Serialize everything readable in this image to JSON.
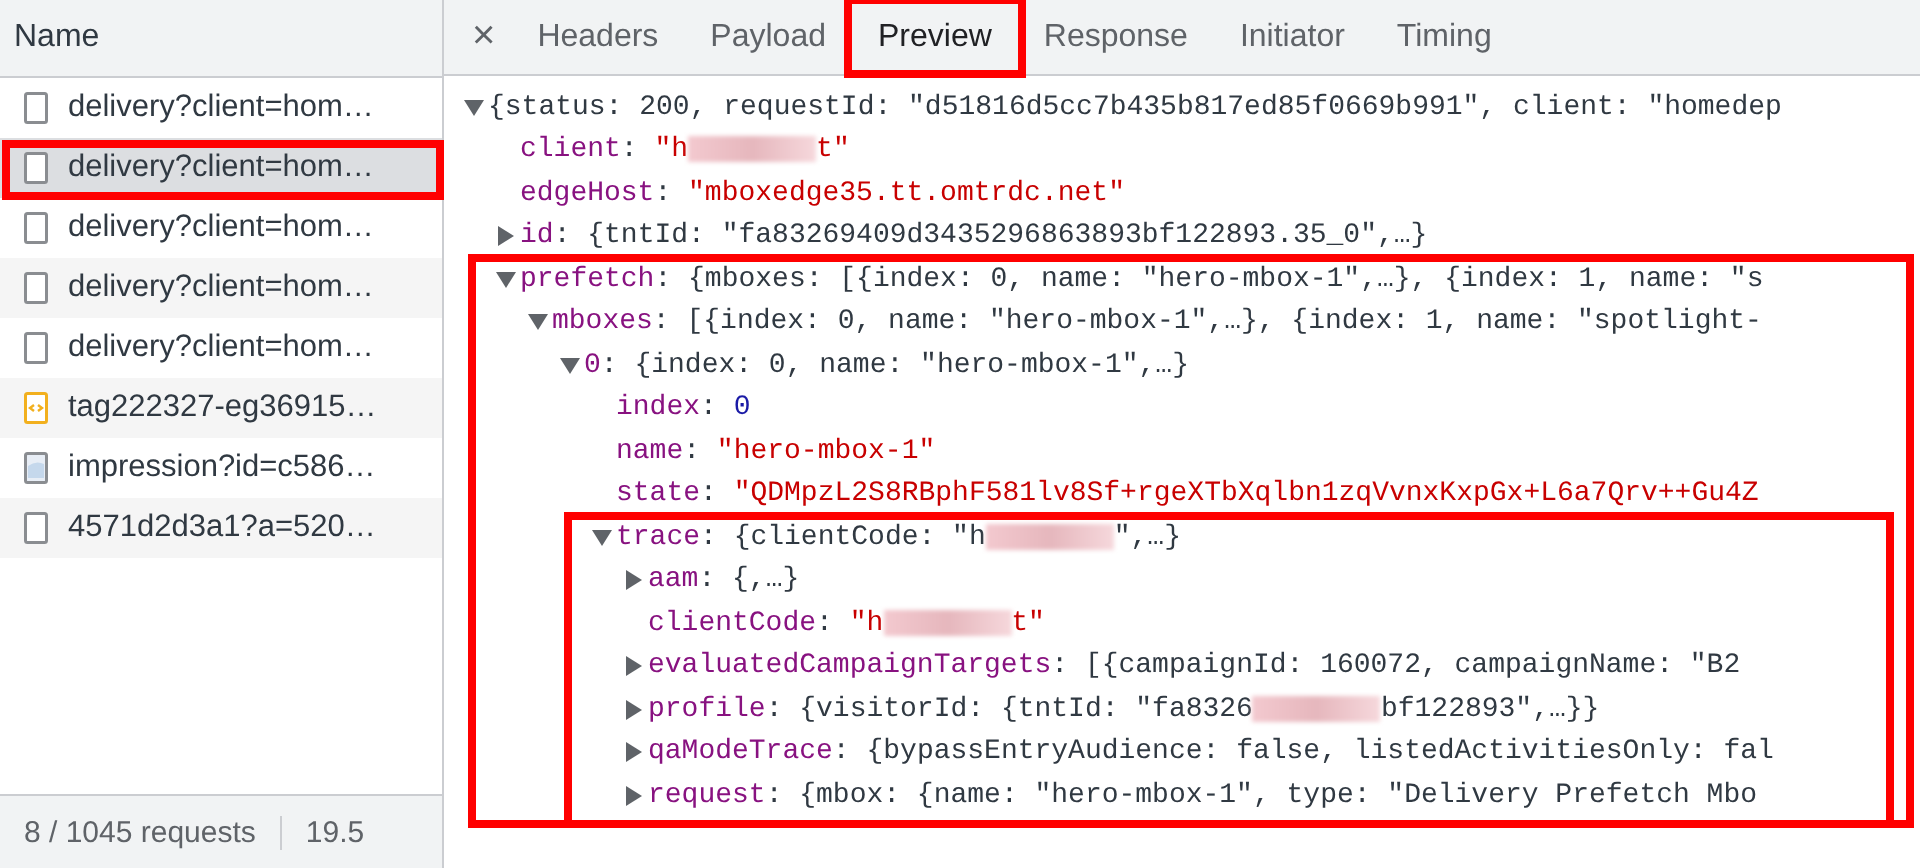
{
  "sidebar": {
    "header": "Name",
    "requests": [
      {
        "name": "delivery?client=hom…",
        "kind": "document",
        "selected": false
      },
      {
        "name": "delivery?client=hom…",
        "kind": "document",
        "selected": true,
        "highlighted": true
      },
      {
        "name": "delivery?client=hom…",
        "kind": "document",
        "selected": false
      },
      {
        "name": "delivery?client=hom…",
        "kind": "document",
        "selected": false
      },
      {
        "name": "delivery?client=hom…",
        "kind": "document",
        "selected": false
      },
      {
        "name": "tag222327-eg36915…",
        "kind": "script",
        "selected": false
      },
      {
        "name": "impression?id=c586…",
        "kind": "image",
        "selected": false
      },
      {
        "name": "4571d2d3a1?a=520…",
        "kind": "document",
        "selected": false
      }
    ],
    "status": [
      "8 / 1045 requests",
      "19.5"
    ]
  },
  "tabs": {
    "close": "×",
    "items": [
      {
        "label": "Headers",
        "selected": false
      },
      {
        "label": "Payload",
        "selected": false
      },
      {
        "label": "Preview",
        "selected": true,
        "highlighted": true
      },
      {
        "label": "Response",
        "selected": false
      },
      {
        "label": "Initiator",
        "selected": false
      },
      {
        "label": "Timing",
        "selected": false
      }
    ]
  },
  "preview": {
    "tree": [
      {
        "expanded": true,
        "value": [
          {
            "kind": "summary",
            "text": "{status: 200, requestId: \"d51816d5cc7b435b817ed85f0669b991\", client: \"homedep"
          }
        ],
        "children": [
          {
            "key": "client",
            "sep": ":",
            "value": [
              {
                "kind": "string",
                "text": "\"h"
              },
              {
                "kind": "redacted"
              },
              {
                "kind": "string",
                "text": "t\""
              }
            ]
          },
          {
            "key": "edgeHost",
            "sep": ":",
            "value": [
              {
                "kind": "string",
                "text": "\"mboxedge35.tt.omtrdc.net\""
              }
            ]
          },
          {
            "key": "id",
            "sep": ":",
            "expanded": false,
            "value": [
              {
                "kind": "summary",
                "text": "{tntId: \"fa83269409d3435296863893bf122893.35_0\",…}"
              }
            ]
          },
          {
            "key": "prefetch",
            "sep": ":",
            "expanded": true,
            "highlighted": true,
            "value": [
              {
                "kind": "summary",
                "text": "{mboxes: [{index: 0, name: \"hero-mbox-1\",…}, {index: 1, name: \"s"
              }
            ],
            "children": [
              {
                "key": "mboxes",
                "sep": ":",
                "expanded": true,
                "value": [
                  {
                    "kind": "summary",
                    "text": "[{index: 0, name: \"hero-mbox-1\",…}, {index: 1, name: \"spotlight-"
                  }
                ],
                "children": [
                  {
                    "key": "0",
                    "sep": ":",
                    "expanded": true,
                    "value": [
                      {
                        "kind": "summary",
                        "text": "{index: 0, name: \"hero-mbox-1\",…}"
                      }
                    ],
                    "children": [
                      {
                        "key": "index",
                        "sep": ":",
                        "value": [
                          {
                            "kind": "number",
                            "text": "0"
                          }
                        ]
                      },
                      {
                        "key": "name",
                        "sep": ":",
                        "value": [
                          {
                            "kind": "string",
                            "text": "\"hero-mbox-1\""
                          }
                        ]
                      },
                      {
                        "key": "state",
                        "sep": ":",
                        "value": [
                          {
                            "kind": "string",
                            "text": "\"QDMpzL2S8RBphF581lv8Sf+rgeXTbXqlbn1zqVvnxKxpGx+L6a7Qrv++Gu4Z"
                          }
                        ]
                      },
                      {
                        "key": "trace",
                        "sep": ":",
                        "expanded": true,
                        "highlighted": true,
                        "value": [
                          {
                            "kind": "summary",
                            "text": "{clientCode: \"h"
                          },
                          {
                            "kind": "redacted"
                          },
                          {
                            "kind": "summary",
                            "text": "\",…}"
                          }
                        ],
                        "children": [
                          {
                            "key": "aam",
                            "sep": ":",
                            "expanded": false,
                            "value": [
                              {
                                "kind": "summary",
                                "text": "{,…}"
                              }
                            ]
                          },
                          {
                            "key": "clientCode",
                            "sep": ":",
                            "value": [
                              {
                                "kind": "string",
                                "text": "\"h"
                              },
                              {
                                "kind": "redacted"
                              },
                              {
                                "kind": "string",
                                "text": "t\""
                              }
                            ]
                          },
                          {
                            "key": "evaluatedCampaignTargets",
                            "sep": ":",
                            "expanded": false,
                            "value": [
                              {
                                "kind": "summary",
                                "text": "[{campaignId: 160072, campaignName: \"B2"
                              }
                            ]
                          },
                          {
                            "key": "profile",
                            "sep": ":",
                            "expanded": false,
                            "value": [
                              {
                                "kind": "summary",
                                "text": "{visitorId: {tntId: \"fa8326"
                              },
                              {
                                "kind": "redacted"
                              },
                              {
                                "kind": "summary",
                                "text": "bf122893\",…}}"
                              }
                            ]
                          },
                          {
                            "key": "qaModeTrace",
                            "sep": ":",
                            "expanded": false,
                            "value": [
                              {
                                "kind": "summary",
                                "text": "{bypassEntryAudience: false, listedActivitiesOnly: fal"
                              }
                            ]
                          },
                          {
                            "key": "request",
                            "sep": ":",
                            "expanded": false,
                            "value": [
                              {
                                "kind": "summary",
                                "text": "{mbox: {name: \"hero-mbox-1\", type: \"Delivery Prefetch Mbo"
                              }
                            ]
                          }
                        ]
                      }
                    ]
                  }
                ]
              }
            ]
          }
        ]
      }
    ]
  }
}
